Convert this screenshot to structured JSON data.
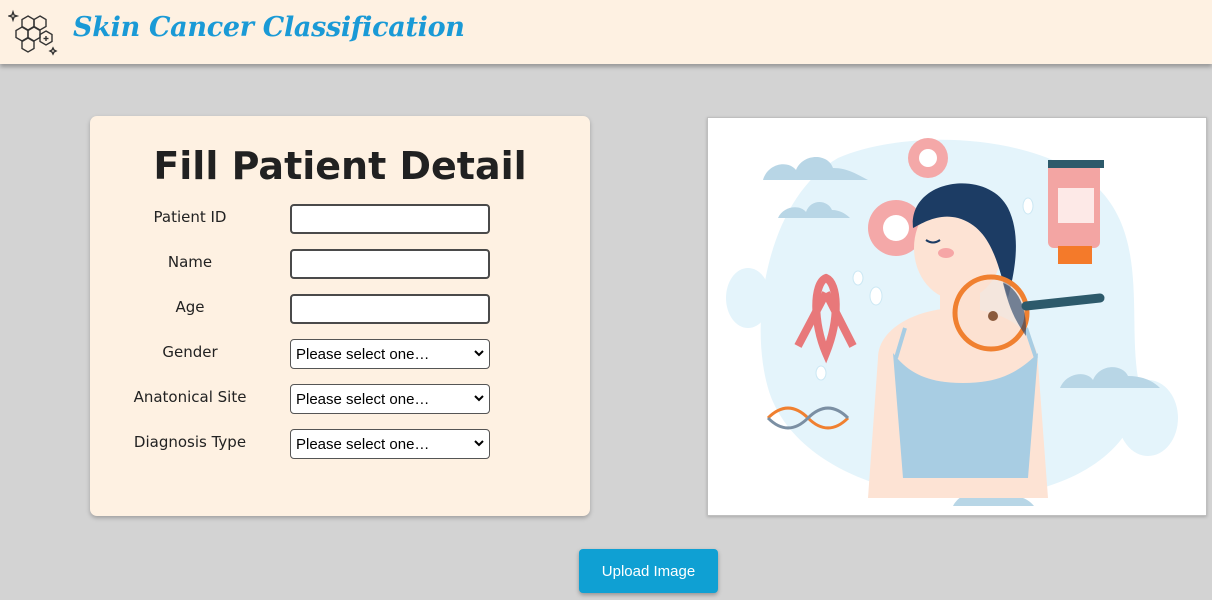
{
  "header": {
    "title": "Skin Cancer Classification",
    "logo_icon": "hexagon-molecule-icon",
    "background": "#fef1e2",
    "title_color": "#1a9ad6"
  },
  "form": {
    "title": "Fill Patient Detail",
    "fields": {
      "patient_id": {
        "label": "Patient ID",
        "value": ""
      },
      "name": {
        "label": "Name",
        "value": ""
      },
      "age": {
        "label": "Age",
        "value": ""
      },
      "gender": {
        "label": "Gender",
        "selected": "Please select one…"
      },
      "anatomical_site": {
        "label": "Anatonical Site",
        "selected": "Please select one…"
      },
      "diagnosis_type": {
        "label": "Diagnosis Type",
        "selected": "Please select one…"
      }
    }
  },
  "illustration": {
    "subject": "woman-with-magnifier-on-mole-illustration"
  },
  "upload": {
    "label": "Upload Image",
    "color": "#0fa0d3"
  }
}
